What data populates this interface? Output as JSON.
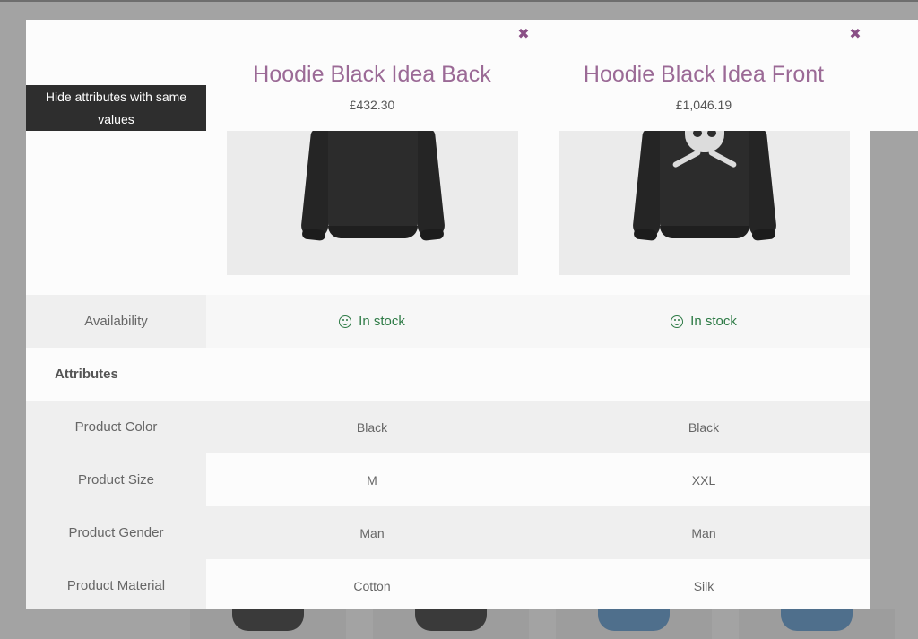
{
  "modal": {
    "hide_button_label": "Hide attributes with same values",
    "close_icon_glyph": "✖"
  },
  "products": [
    {
      "title": "Hoodie Black Idea Back",
      "price": "£432.30",
      "image_icon": "hoodie-back-image"
    },
    {
      "title": "Hoodie Black Idea Front",
      "price": "£1,046.19",
      "image_icon": "hoodie-front-image"
    }
  ],
  "availability": {
    "label": "Availability",
    "values": [
      "In stock",
      "In stock"
    ]
  },
  "attributes": {
    "heading": "Attributes",
    "rows": [
      {
        "label": "Product Color",
        "values": [
          "Black",
          "Black"
        ]
      },
      {
        "label": "Product Size",
        "values": [
          "M",
          "XXL"
        ]
      },
      {
        "label": "Product Gender",
        "values": [
          "Man",
          "Man"
        ]
      },
      {
        "label": "Product Material",
        "values": [
          "Cotton",
          "Silk"
        ]
      }
    ]
  },
  "colors": {
    "title": "#9b6a96",
    "close_icon": "#8a4f86",
    "in_stock": "#2d7a45",
    "button_bg": "#2e2e2e"
  }
}
